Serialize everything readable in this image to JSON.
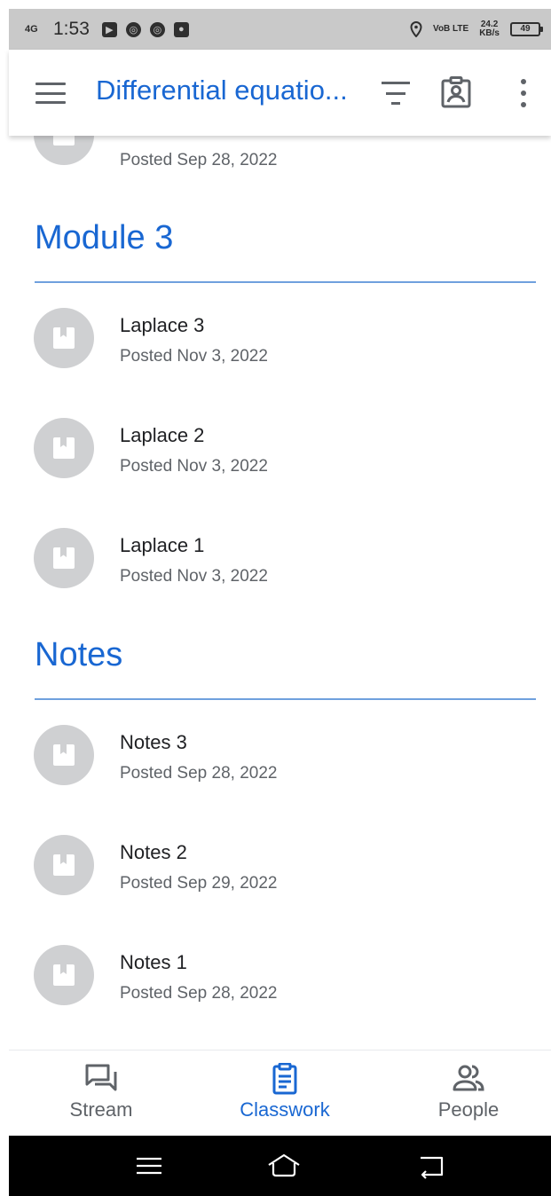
{
  "status_bar": {
    "network": "4G",
    "time": "1:53",
    "volte": "VoB LTE",
    "speed_value": "24.2",
    "speed_unit": "KB/s",
    "battery": "49"
  },
  "app_bar": {
    "title": "Differential equatio..."
  },
  "partial_item": {
    "date": "Posted Sep 28, 2022"
  },
  "sections": [
    {
      "heading": "Module 3",
      "items": [
        {
          "title": "Laplace 3",
          "date": "Posted Nov 3, 2022"
        },
        {
          "title": "Laplace 2",
          "date": "Posted Nov 3, 2022"
        },
        {
          "title": "Laplace 1",
          "date": "Posted Nov 3, 2022"
        }
      ]
    },
    {
      "heading": "Notes",
      "items": [
        {
          "title": "Notes 3",
          "date": "Posted Sep 28, 2022"
        },
        {
          "title": "Notes 2",
          "date": "Posted Sep 29, 2022"
        },
        {
          "title": "Notes 1",
          "date": "Posted Sep 28, 2022"
        }
      ]
    }
  ],
  "bottom_nav": {
    "items": [
      {
        "label": "Stream",
        "icon": "stream-icon",
        "active": false
      },
      {
        "label": "Classwork",
        "icon": "classwork-icon",
        "active": true
      },
      {
        "label": "People",
        "icon": "people-icon",
        "active": false
      }
    ]
  },
  "colors": {
    "accent": "#1967d2",
    "icon_circle": "#cfd0d2",
    "status_bar": "#c9c9c9",
    "text_secondary": "#5f6368"
  }
}
